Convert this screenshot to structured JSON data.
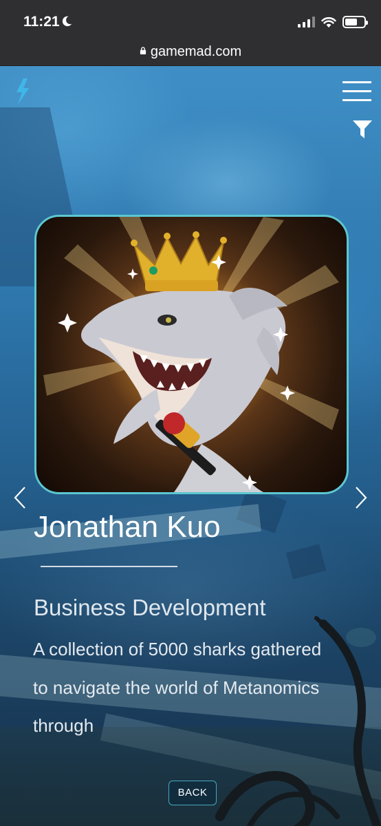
{
  "status_bar": {
    "time": "11:21",
    "moon_icon": "moon-icon",
    "signal_icon": "signal-icon",
    "wifi_icon": "wifi-icon",
    "battery_icon": "battery-icon"
  },
  "browser": {
    "url": "gamemad.com",
    "lock_icon": "lock-icon"
  },
  "header": {
    "logo_icon": "lightning-bolt-icon",
    "menu_icon": "hamburger-menu-icon",
    "filter_icon": "filter-icon"
  },
  "profile": {
    "image": "crowned-diamond-shark-illustration",
    "name": "Jonathan Kuo",
    "role": "Business Development",
    "description": "A collection of 5000 sharks gathered to navigate the world of Metanomics through"
  },
  "nav": {
    "prev_icon": "chevron-left-icon",
    "next_icon": "chevron-right-icon",
    "back_label": "BACK"
  },
  "colors": {
    "accent": "#5dc7d0",
    "bolt": "#3fb7e8",
    "crown": "#e2b12c"
  }
}
